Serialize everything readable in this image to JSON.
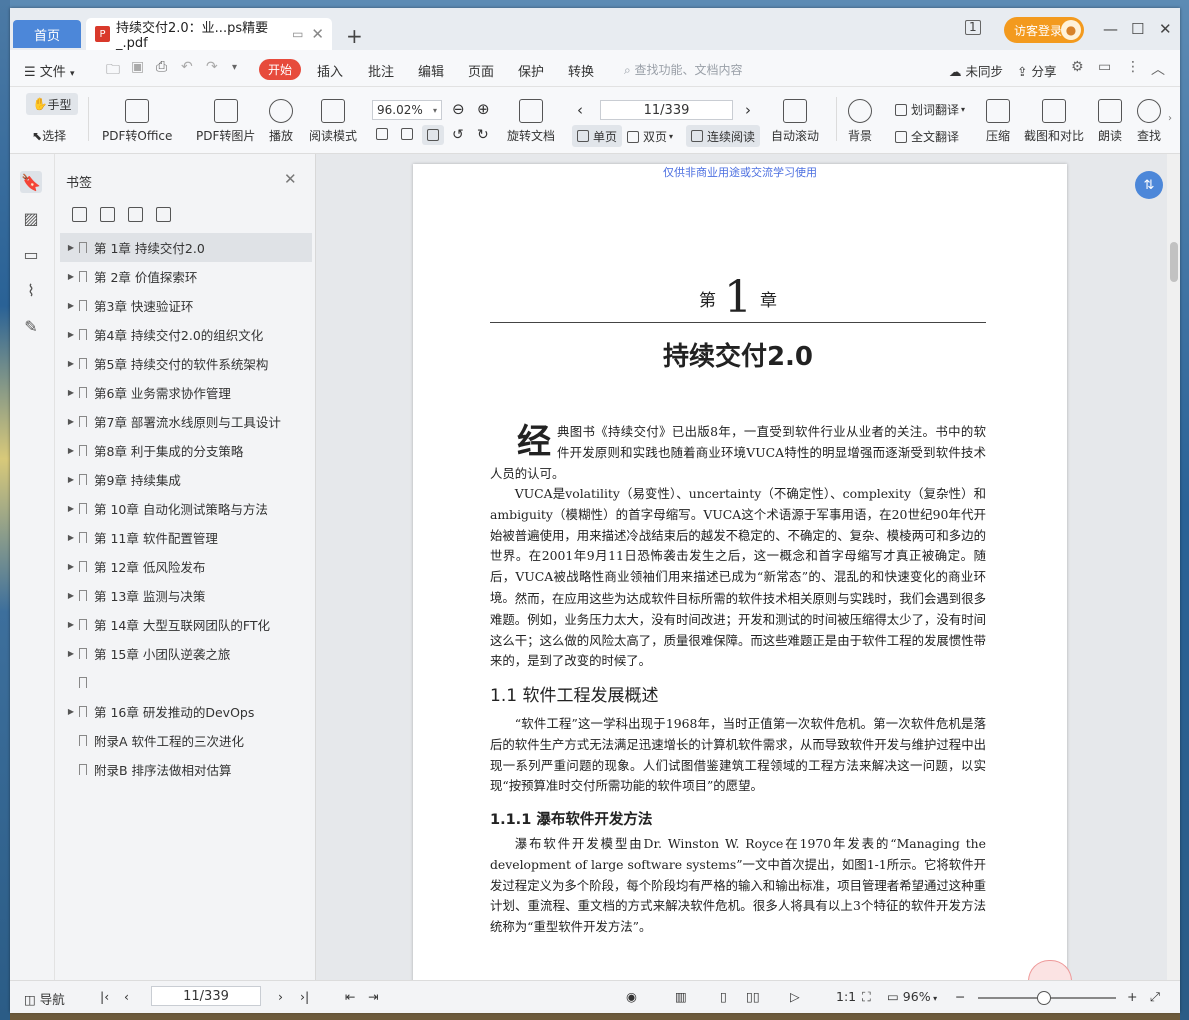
{
  "tabs": {
    "home": "首页",
    "doc_title": "持续交付2.0：业...ps精要_.pdf",
    "doc_icon": "P"
  },
  "titlebar": {
    "page_indicator": "1",
    "login": "访客登录"
  },
  "menu": {
    "file": "文件",
    "start": "开始",
    "items": [
      "插入",
      "批注",
      "编辑",
      "页面",
      "保护",
      "转换"
    ],
    "search_placeholder": "查找功能、文档内容",
    "sync": "未同步",
    "share": "分享"
  },
  "toolbar": {
    "hand": "手型",
    "select": "选择",
    "pdf_to_office": "PDF转Office",
    "pdf_to_image": "PDF转图片",
    "play": "播放",
    "read_mode": "阅读模式",
    "zoom": "96.02%",
    "page": "11/339",
    "rotate": "旋转文档",
    "single": "单页",
    "double": "双页",
    "continuous": "连续阅读",
    "auto_scroll": "自动滚动",
    "background": "背景",
    "word_translate": "划词翻译",
    "full_translate": "全文翻译",
    "compress": "压缩",
    "screenshot_compare": "截图和对比",
    "read_aloud": "朗读",
    "find": "查找"
  },
  "bookmarks": {
    "title": "书签",
    "items": [
      {
        "label": "第 1章 持续交付2.0",
        "arrow": true,
        "selected": true
      },
      {
        "label": "第 2章 价值探索环",
        "arrow": true
      },
      {
        "label": "第3章 快速验证环",
        "arrow": true
      },
      {
        "label": "第4章 持续交付2.0的组织文化",
        "arrow": true
      },
      {
        "label": "第5章 持续交付的软件系统架构",
        "arrow": true
      },
      {
        "label": "第6章 业务需求协作管理",
        "arrow": true
      },
      {
        "label": "第7章 部署流水线原则与工具设计",
        "arrow": true
      },
      {
        "label": "第8章 利于集成的分支策略",
        "arrow": true
      },
      {
        "label": "第9章 持续集成",
        "arrow": true
      },
      {
        "label": "第 10章 自动化测试策略与方法",
        "arrow": true
      },
      {
        "label": "第 11章 软件配置管理",
        "arrow": true
      },
      {
        "label": "第 12章 低风险发布",
        "arrow": true
      },
      {
        "label": "第 13章 监测与决策",
        "arrow": true
      },
      {
        "label": "第 14章 大型互联网团队的FT化",
        "arrow": true
      },
      {
        "label": "第 15章 小团队逆袭之旅",
        "arrow": true
      },
      {
        "label": "",
        "arrow": false
      },
      {
        "label": "第 16章 研发推动的DevOps",
        "arrow": true
      },
      {
        "label": "附录A 软件工程的三次进化",
        "arrow": false
      },
      {
        "label": "附录B 排序法做相对估算",
        "arrow": false
      }
    ]
  },
  "page_content": {
    "watermark": "仅供非商业用途或交流学习使用",
    "chapter_di": "第",
    "chapter_num": "1",
    "chapter_zhang": "章",
    "chapter_title": "持续交付2.0",
    "dropcap": "经",
    "p1": "典图书《持续交付》已出版8年，一直受到软件行业从业者的关注。书中的软件开发原则和实践也随着商业环境VUCA特性的明显增强而逐渐受到软件技术人员的认可。",
    "p2": "VUCA是volatility（易变性）、uncertainty（不确定性）、complexity（复杂性）和ambiguity（模糊性）的首字母缩写。VUCA这个术语源于军事用语，在20世纪90年代开始被普遍使用，用来描述冷战结束后的越发不稳定的、不确定的、复杂、模棱两可和多边的世界。在2001年9月11日恐怖袭击发生之后，这一概念和首字母缩写才真正被确定。随后，VUCA被战略性商业领袖们用来描述已成为“新常态”的、混乱的和快速变化的商业环境。",
    "p3": "然而，在应用这些为达成软件目标所需的软件技术相关原则与实践时，我们会遇到很多难题。例如，业务压力太大，没有时间改进；开发和测试的时间被压缩得太少了，没有时间这么干；这么做的风险太高了，质量很难保障。而这些难题正是由于软件工程的发展惯性带来的，是到了改变的时候了。",
    "sec1": "1.1   软件工程发展概述",
    "p4": "“软件工程”这一学科出现于1968年，当时正值第一次软件危机。第一次软件危机是落后的软件生产方式无法满足迅速增长的计算机软件需求，从而导致软件开发与维护过程中出现一系列严重问题的现象。人们试图借鉴建筑工程领域的工程方法来解决这一问题，以实现“按预算准时交付所需功能的软件项目”的愿望。",
    "sec2": "1.1.1   瀑布软件开发方法",
    "p5": "瀑布软件开发模型由Dr. Winston W. Royce在1970年发表的“Managing the development of large software systems”一文中首次提出，如图1-1所示。它将软件开发过程定义为多个阶段，每个阶段均有严格的输入和输出标准，项目管理者希望通过这种重计划、重流程、重文档的方式来解决软件危机。很多人将具有以上3个特征的软件开发方法统称为“重型软件开发方法”。"
  },
  "statusbar": {
    "nav": "导航",
    "page": "11/339",
    "zoom": "96%"
  }
}
